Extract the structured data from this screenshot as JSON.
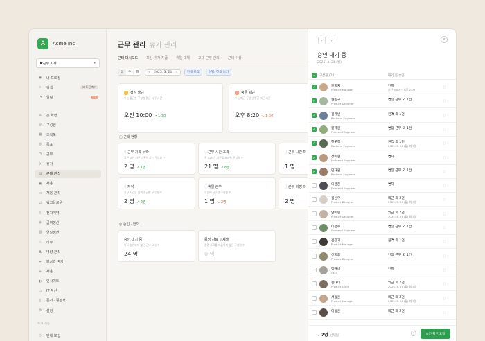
{
  "app": {
    "name": "Acme Inc.",
    "logo": "A"
  },
  "sidebar": {
    "punch": "근무 시작",
    "top_items": [
      {
        "label": "내 프로필",
        "icon": "person-icon"
      },
      {
        "label": "검색",
        "icon": "search-icon",
        "badge": "⌘ K 단축키"
      },
      {
        "label": "알림",
        "icon": "bell-icon",
        "badge": "12"
      }
    ],
    "items": [
      {
        "label": "홈 화면",
        "icon": "home-icon"
      },
      {
        "label": "구성원",
        "icon": "people-icon"
      },
      {
        "label": "조직도",
        "icon": "org-icon"
      },
      {
        "label": "목표",
        "icon": "target-icon"
      },
      {
        "label": "근무",
        "icon": "clock-icon"
      },
      {
        "label": "휴가",
        "icon": "plane-icon"
      },
      {
        "label": "근태 관리",
        "icon": "calendar-icon"
      },
      {
        "label": "채용",
        "icon": "briefcase-icon"
      },
      {
        "label": "채용 관리",
        "icon": "folder-icon"
      },
      {
        "label": "워크플로우",
        "icon": "flow-icon"
      },
      {
        "label": "전자계약",
        "icon": "document-icon"
      },
      {
        "label": "급여정산",
        "icon": "money-icon"
      },
      {
        "label": "연말정산",
        "icon": "receipt-icon"
      },
      {
        "label": "리뷰",
        "icon": "star-icon"
      },
      {
        "label": "역량 관리",
        "icon": "chart-icon"
      },
      {
        "label": "보상과 평가",
        "icon": "award-icon"
      },
      {
        "label": "채용",
        "icon": "user-plus-icon"
      },
      {
        "label": "인사이트",
        "icon": "insight-icon"
      },
      {
        "label": "IT 자산",
        "icon": "laptop-icon"
      },
      {
        "label": "문서 · 증명서",
        "icon": "file-icon"
      },
      {
        "label": "설정",
        "icon": "gear-icon"
      }
    ],
    "group_label": "추가 기능",
    "bottom_item": {
      "label": "단체 보험",
      "icon": "shield-icon"
    }
  },
  "main": {
    "title": "근무 관리",
    "title_alt": "휴가 관리",
    "tabs": [
      "근태 대시보드",
      "보상 휴가 지급",
      "휴일 대체",
      "교대 근무 관리",
      "근태 이상"
    ],
    "filter": {
      "segments": [
        "일",
        "주",
        "월"
      ],
      "date": "2025. 3. 24",
      "chips": [
        "전체 조직",
        "성별: 전체 보기"
      ]
    },
    "today": [
      {
        "title": "정상 출근",
        "desc": "오늘 출근한 구성원 평균 시작 시간",
        "value": "오전 10:00",
        "trend": "1:30",
        "dir": "up",
        "color": "#f5c542"
      },
      {
        "title": "평균 퇴근",
        "desc": "오늘 퇴근 구성원 평균 퇴근 시간",
        "value": "오후 8:20",
        "trend": "1:30",
        "dir": "down",
        "color": "#f3a287"
      }
    ],
    "sections": {
      "status": "근태 현황",
      "approval": "승인 · 합의"
    },
    "status_cards": [
      {
        "title": "근무 기록 누락",
        "desc": "출근 또는 퇴근 기록이 없는 구성원 수",
        "value": "2 명",
        "trend": "1명",
        "dir": "up"
      },
      {
        "title": "근무 시간 초과",
        "desc": "주 52시간 기준을 초과한 구성원 수",
        "value": "21 명",
        "trend": "8명",
        "dir": "up"
      },
      {
        "title": "근무 시간 미",
        "desc": "",
        "value": "1 명",
        "trend": "",
        "dir": "up"
      },
      {
        "title": "지각",
        "desc": "출근 시간을 넘겨 출근한 구성원 수",
        "value": "2 명",
        "trend": "2명",
        "dir": "up"
      },
      {
        "title": "휴일 근무",
        "desc": "휴일에 근무한 구성원 수",
        "value": "1 명",
        "trend": "2명",
        "dir": "down"
      },
      {
        "title": "근무 지정 이",
        "desc": "",
        "value": "2 명",
        "trend": "",
        "dir": "up"
      }
    ],
    "approval_cards": [
      {
        "title": "승인 대기 중",
        "desc": "아직 승인되지 않은 근태 요청 수",
        "value": "24 명"
      },
      {
        "title": "증명 자료 미제출",
        "desc": "증명 자료를 제출하지 않은 구성원 수",
        "value": "0 명"
      }
    ]
  },
  "panel": {
    "title": "승인 대기 중",
    "date": "2025. 3. 24 (월)",
    "col_member": "구성원 (24)",
    "col_request": "대기 중 승인",
    "rows": [
      {
        "name": "안희지",
        "role": "Product Manager",
        "leave": "연차",
        "time": "오전 9:00 ~ 오후 2:00",
        "checked": true,
        "color": "#c9a98c"
      },
      {
        "name": "권민구",
        "role": "Product Designer",
        "leave": "연장 근무 외 1건",
        "time": "",
        "checked": true,
        "color": "#a7b8a0"
      },
      {
        "name": "김유빈",
        "role": "Backend Engineer",
        "leave": "원격 외 1건",
        "time": "",
        "checked": true,
        "color": "#6e7f9b"
      },
      {
        "name": "권혜원",
        "role": "Frontend Engineer",
        "leave": "연장 근무 외 1건",
        "time": "",
        "checked": true,
        "color": "#8fae7c"
      },
      {
        "name": "천우경",
        "role": "Backend Engineer",
        "leave": "원격 외 1건",
        "time": "2025. 3. 24 (월) 외 3일",
        "checked": true,
        "color": "#5a6b54"
      },
      {
        "name": "정이현",
        "role": "Frontend Engineer",
        "leave": "연차",
        "time": "",
        "checked": true,
        "color": "#b99a7e"
      },
      {
        "name": "민재원",
        "role": "Backend Engineer",
        "leave": "연장 근무 외 1건",
        "time": "",
        "checked": true,
        "color": "#9a7d68"
      },
      {
        "name": "이윤준",
        "role": "Frontend Engineer",
        "leave": "연차",
        "time": "",
        "checked": false,
        "color": "#4e4e56"
      },
      {
        "name": "김신우",
        "role": "Product Designer",
        "leave": "외근 외 2건",
        "time": "2025. 3. 24 (월) 외 3일",
        "checked": false,
        "color": "#d6cfc7"
      },
      {
        "name": "안미림",
        "role": "Product Designer",
        "leave": "외근 외 2건",
        "time": "2025. 3. 24 (월) 외 3일",
        "checked": false,
        "color": "#c2b2a4"
      },
      {
        "name": "이정수",
        "role": "Frontend Engineer",
        "leave": "연장 근무 외 1건",
        "time": "",
        "checked": false,
        "color": "#6f8f6a"
      },
      {
        "name": "김장기",
        "role": "Product Manager",
        "leave": "원격 외 1건",
        "time": "",
        "checked": false,
        "color": "#3e3a38"
      },
      {
        "name": "신지호",
        "role": "Product Designer",
        "leave": "연장 근무 외 1건",
        "time": "",
        "checked": false,
        "color": "#8f8a6b"
      },
      {
        "name": "정해나",
        "role": "CEO",
        "leave": "연차",
        "time": "",
        "checked": false,
        "color": "#a6a19b"
      },
      {
        "name": "김태이",
        "role": "Product Lead",
        "leave": "외근 외 2건",
        "time": "2025. 3. 24 (월) 외 3일",
        "checked": false,
        "color": "#7d6e62"
      },
      {
        "name": "서동훈",
        "role": "Product Manager",
        "leave": "외근 외 2건",
        "time": "2025. 3. 24 (월) 외 3일",
        "checked": false,
        "color": "#c4a88e"
      },
      {
        "name": "이동훈",
        "role": "",
        "leave": "외근 외 2건",
        "time": "",
        "checked": false,
        "color": "#5b5048"
      }
    ],
    "footer": {
      "count": "7명",
      "label": "선택됨",
      "approve": "승인 확인 요청"
    }
  }
}
